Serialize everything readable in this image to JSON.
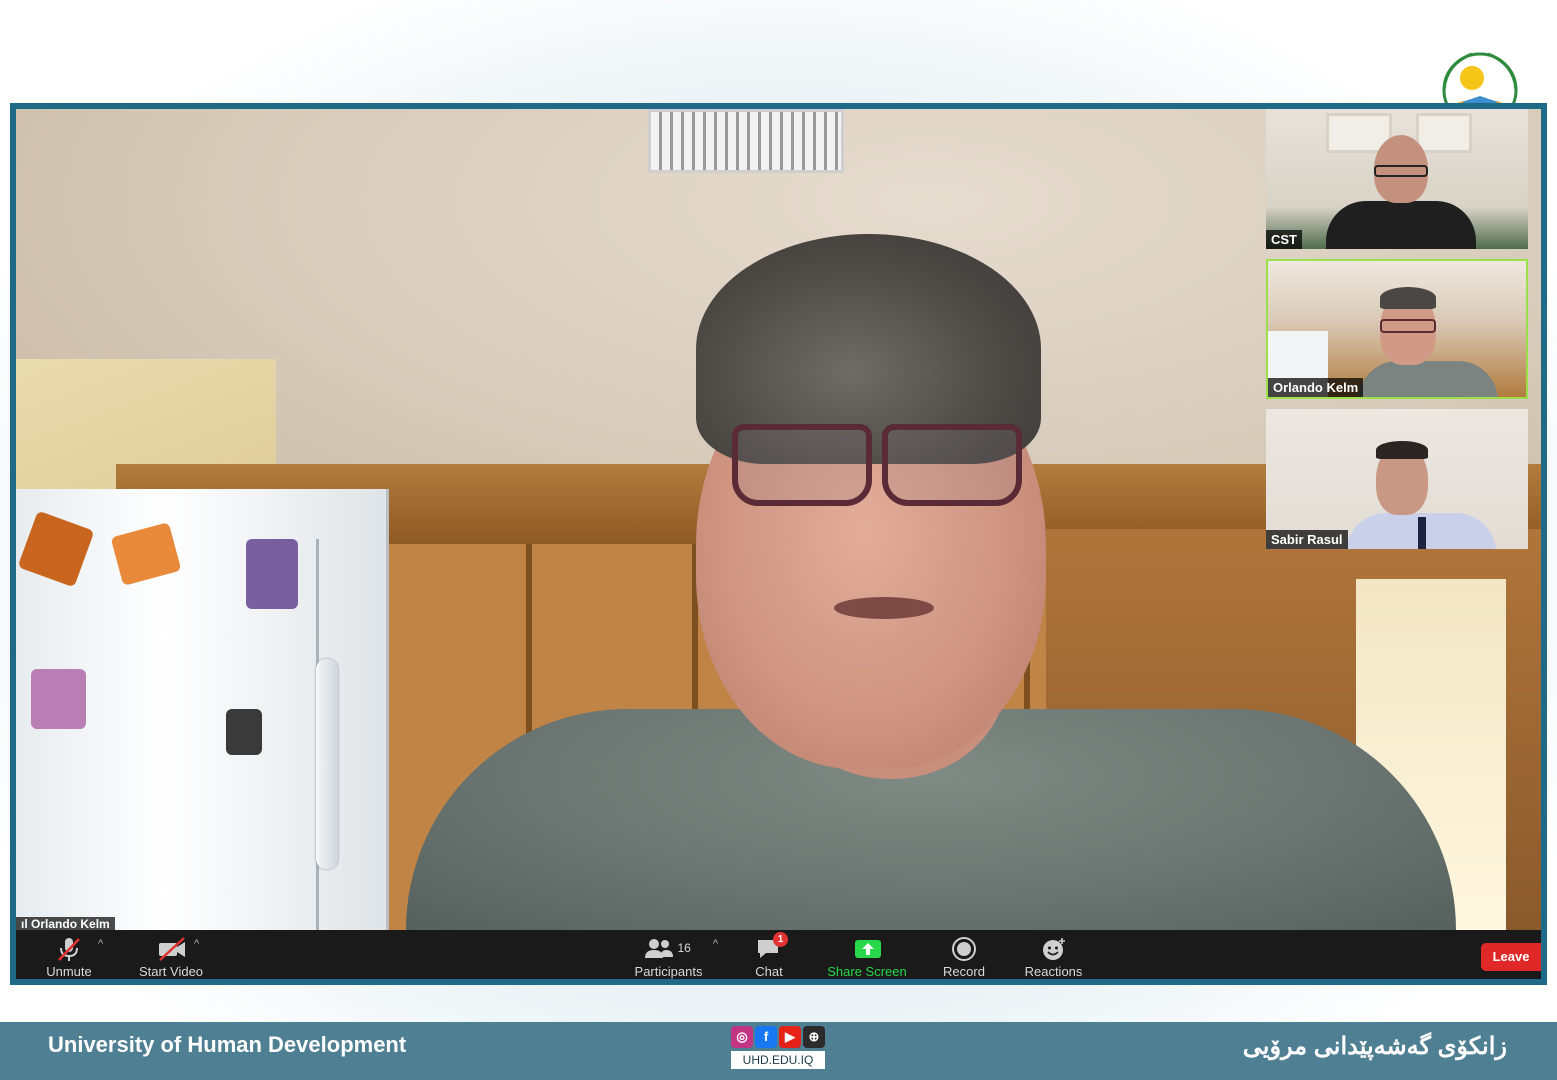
{
  "main_video": {
    "speaker_name": "Orlando Kelm"
  },
  "thumbnails": [
    {
      "name": "CST",
      "active": false
    },
    {
      "name": "Orlando Kelm",
      "active": true
    },
    {
      "name": "Sabir Rasul",
      "active": false
    }
  ],
  "toolbar": {
    "unmute_label": "Unmute",
    "start_video_label": "Start Video",
    "participants_label": "Participants",
    "participants_count": "16",
    "chat_label": "Chat",
    "chat_badge": "1",
    "share_screen_label": "Share Screen",
    "record_label": "Record",
    "reactions_label": "Reactions",
    "leave_label": "Leave"
  },
  "footer": {
    "english_name": "University of Human Development",
    "kurdish_name": "زانکۆی گەشەپێدانی مرۆیی",
    "website": "UHD.EDU.IQ"
  },
  "colors": {
    "frame_border": "#1f6a86",
    "footer_bg": "#4f7f93",
    "share_green": "#27d84a",
    "leave_red": "#e02828"
  }
}
